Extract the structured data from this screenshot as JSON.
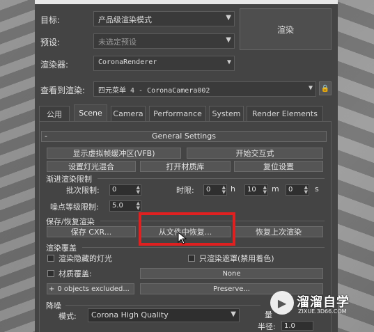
{
  "settings": {
    "target_label": "目标:",
    "target_value": "产品级渲染模式",
    "preset_label": "预设:",
    "preset_value": "未选定预设",
    "renderer_label": "渲染器:",
    "renderer_value": "CoronaRenderer",
    "view_label": "查看到渲染:",
    "view_value": "四元菜单 4 - CoronaCamera002",
    "render_button": "渲染"
  },
  "tabs": [
    "公用",
    "Scene",
    "Camera",
    "Performance",
    "System",
    "Render Elements"
  ],
  "active_tab": "Scene",
  "general": {
    "title": "General Settings",
    "collapse": "-",
    "vfb_button": "显示虚拟帧缓冲区(VFB)",
    "interactive_button": "开始交互式",
    "lightmix_button": "设置灯光混合",
    "material_library_button": "打开材质库",
    "reset_button": "复位设置"
  },
  "progressive": {
    "title": "渐进渲染限制",
    "pass_limit_label": "批次限制:",
    "pass_limit_value": "0",
    "time_limit_label": "时限:",
    "hours_value": "0",
    "hours_unit": "h",
    "minutes_value": "10",
    "minutes_unit": "m",
    "seconds_value": "0",
    "seconds_unit": "s",
    "noise_label": "噪点等级限制:",
    "noise_value": "5.0"
  },
  "save_restore": {
    "title": "保存/恢复渲染",
    "save_button": "保存 CXR...",
    "restore_file_button": "从文件中恢复...",
    "resume_button": "恢复上次渲染"
  },
  "override": {
    "title": "渲染覆盖",
    "hidden_lights_label": "渲染隐藏的灯光",
    "mask_only_label": "只渲染遮罩(禁用着色)",
    "material_override_label": "材质覆盖:",
    "material_override_value": "None",
    "excluded_button": "0 objects excluded...",
    "excluded_prefix": "+",
    "preserve_button": "Preserve..."
  },
  "denoise": {
    "title": "降噪",
    "mode_label": "模式:",
    "mode_value": "Corona High Quality",
    "extra_label": "量",
    "radius_label": "半径:",
    "radius_value": "1.0"
  },
  "watermark": {
    "brand": "溜溜自学",
    "url": "ZIXUE.3D66.COM"
  },
  "colors": {
    "highlight": "#e02020",
    "panel": "#444444"
  }
}
